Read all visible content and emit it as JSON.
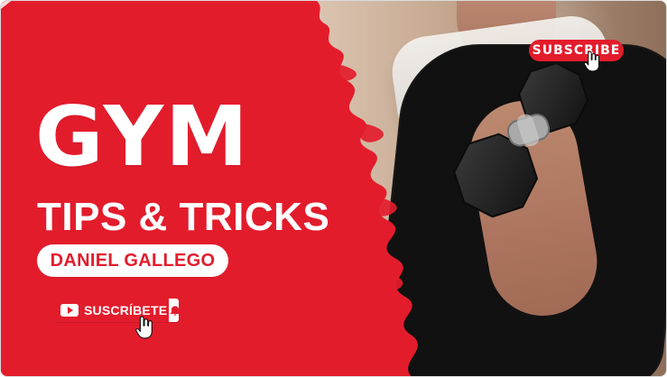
{
  "thumbnail": {
    "title": "GYM",
    "subtitle": "TIPS & TRICKS",
    "author": "DANIEL GALLEGO"
  },
  "buttons": {
    "subscribe_es": "SUSCRÍBETE",
    "subscribe_en": "SUBSCRIBE"
  },
  "icons": {
    "youtube": "youtube-icon",
    "bell": "bell-icon",
    "cursor": "hand-cursor-icon",
    "dumbbell": "dumbbell-icon"
  },
  "colors": {
    "accent_red": "#e31c2c",
    "white": "#ffffff",
    "text_red": "#e31c2c"
  }
}
